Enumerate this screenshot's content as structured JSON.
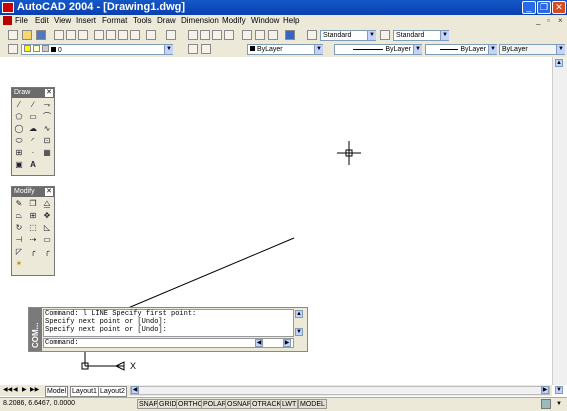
{
  "window": {
    "title": "AutoCAD 2004 - [Drawing1.dwg]",
    "controls": [
      "_",
      "❐",
      "✕"
    ]
  },
  "menu": {
    "items": [
      "File",
      "Edit",
      "View",
      "Insert",
      "Format",
      "Tools",
      "Draw",
      "Dimension",
      "Modify",
      "Window",
      "Help"
    ],
    "doc_controls": [
      "_",
      "▫",
      "×"
    ]
  },
  "styles_toolbar": {
    "text_style": "Standard",
    "dim_style": "Standard"
  },
  "layers_toolbar": {
    "current_layer": "0"
  },
  "properties_toolbar": {
    "color": "ByLayer",
    "linetype": "ByLayer",
    "lineweight": "ByLayer",
    "plotstyle": "ByLayer"
  },
  "draw_palette": {
    "title": "Draw",
    "close": "✕",
    "text_tool": "A"
  },
  "modify_palette": {
    "title": "Modify",
    "close": "✕"
  },
  "command_window": {
    "handle_label": "COM...",
    "history": [
      "Command: l LINE Specify first point:",
      "Specify next point or [Undo]:",
      "Specify next point or [Undo]:"
    ],
    "prompt": "Command:"
  },
  "ucs": {
    "x_label": "X"
  },
  "layout_tabs": {
    "nav": [
      "◀◀",
      "◀",
      "▶",
      "▶▶"
    ],
    "tabs": [
      "Model",
      "Layout1",
      "Layout2"
    ]
  },
  "statusbar": {
    "coordinates": "8.2086, 6.6467, 0.0000",
    "toggles": [
      "SNAP",
      "GRID",
      "ORTHO",
      "POLAR",
      "OSNAP",
      "OTRACK",
      "LWT",
      "MODEL"
    ]
  }
}
